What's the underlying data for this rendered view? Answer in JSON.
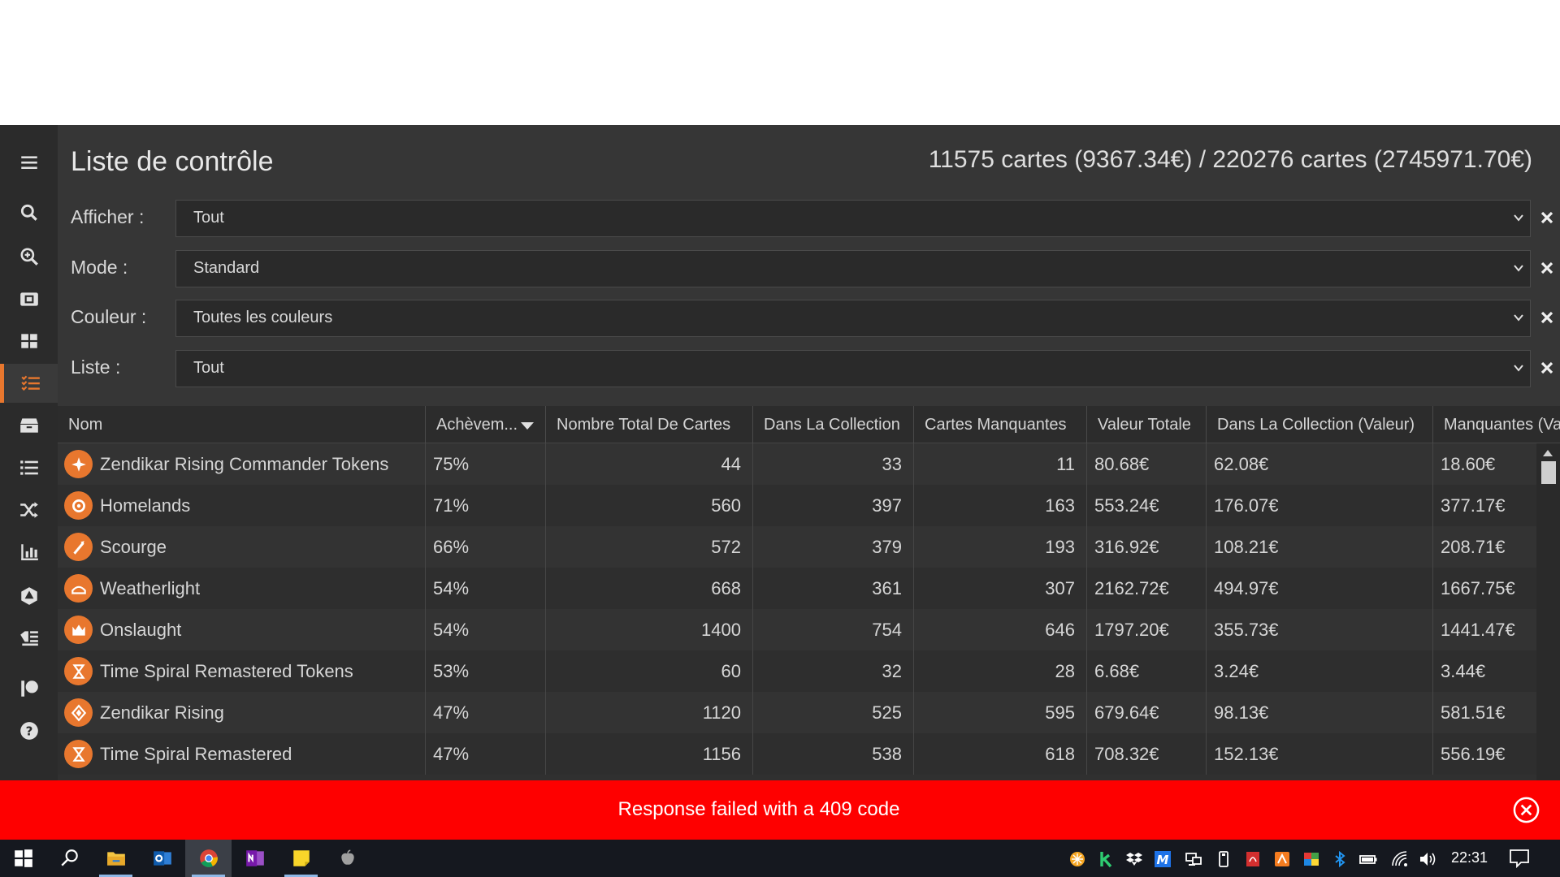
{
  "header": {
    "title": "Liste de contrôle",
    "totals": "11575 cartes (9367.34€) / 220276 cartes (2745971.70€)"
  },
  "filters": [
    {
      "label": "Afficher :",
      "value": "Tout"
    },
    {
      "label": "Mode :",
      "value": "Standard"
    },
    {
      "label": "Couleur :",
      "value": "Toutes les couleurs"
    },
    {
      "label": "Liste :",
      "value": "Tout"
    }
  ],
  "sidebar": {
    "items": [
      {
        "icon": "menu-icon"
      },
      {
        "icon": "search-icon"
      },
      {
        "icon": "zoom-in-icon"
      },
      {
        "icon": "card-scan-icon"
      },
      {
        "icon": "grid-icon"
      },
      {
        "icon": "checklist-icon",
        "active": true
      },
      {
        "icon": "box-icon"
      },
      {
        "icon": "list-icon"
      },
      {
        "icon": "shuffle-icon"
      },
      {
        "icon": "bar-chart-icon"
      },
      {
        "icon": "dice-icon"
      },
      {
        "icon": "price-tags-icon"
      },
      {
        "icon": "flag-icon"
      },
      {
        "icon": "help-icon"
      }
    ]
  },
  "table": {
    "columns": [
      "Nom",
      "Achèvem...",
      "Nombre Total De Cartes",
      "Dans La Collection",
      "Cartes Manquantes",
      "Valeur Totale",
      "Dans La Collection (Valeur)",
      "Manquantes (Val"
    ],
    "sorted_column": "Achèvem...",
    "rows": [
      {
        "name": "Zendikar Rising Commander Tokens",
        "completion": "75%",
        "total": "44",
        "in_collection": "33",
        "missing": "11",
        "total_value": "80.68€",
        "collection_value": "62.08€",
        "missing_value": "18.60€"
      },
      {
        "name": "Homelands",
        "completion": "71%",
        "total": "560",
        "in_collection": "397",
        "missing": "163",
        "total_value": "553.24€",
        "collection_value": "176.07€",
        "missing_value": "377.17€"
      },
      {
        "name": "Scourge",
        "completion": "66%",
        "total": "572",
        "in_collection": "379",
        "missing": "193",
        "total_value": "316.92€",
        "collection_value": "108.21€",
        "missing_value": "208.71€"
      },
      {
        "name": "Weatherlight",
        "completion": "54%",
        "total": "668",
        "in_collection": "361",
        "missing": "307",
        "total_value": "2162.72€",
        "collection_value": "494.97€",
        "missing_value": "1667.75€"
      },
      {
        "name": "Onslaught",
        "completion": "54%",
        "total": "1400",
        "in_collection": "754",
        "missing": "646",
        "total_value": "1797.20€",
        "collection_value": "355.73€",
        "missing_value": "1441.47€"
      },
      {
        "name": "Time Spiral Remastered Tokens",
        "completion": "53%",
        "total": "60",
        "in_collection": "32",
        "missing": "28",
        "total_value": "6.68€",
        "collection_value": "3.24€",
        "missing_value": "3.44€"
      },
      {
        "name": "Zendikar Rising",
        "completion": "47%",
        "total": "1120",
        "in_collection": "525",
        "missing": "595",
        "total_value": "679.64€",
        "collection_value": "98.13€",
        "missing_value": "581.51€"
      },
      {
        "name": "Time Spiral Remastered",
        "completion": "47%",
        "total": "1156",
        "in_collection": "538",
        "missing": "618",
        "total_value": "708.32€",
        "collection_value": "152.13€",
        "missing_value": "556.19€"
      }
    ]
  },
  "error": {
    "message": "Response failed with a 409 code"
  },
  "taskbar": {
    "clock": "22:31",
    "apps": [
      "windows-start-icon",
      "search-icon",
      "file-explorer-icon",
      "outlook-icon",
      "chrome-icon",
      "onenote-icon",
      "sticky-notes-icon",
      "apple-icon"
    ]
  },
  "colors": {
    "accent": "#e8772e",
    "error": "#fe0000",
    "background": "#363636",
    "sidebar": "#2b2b2b"
  }
}
